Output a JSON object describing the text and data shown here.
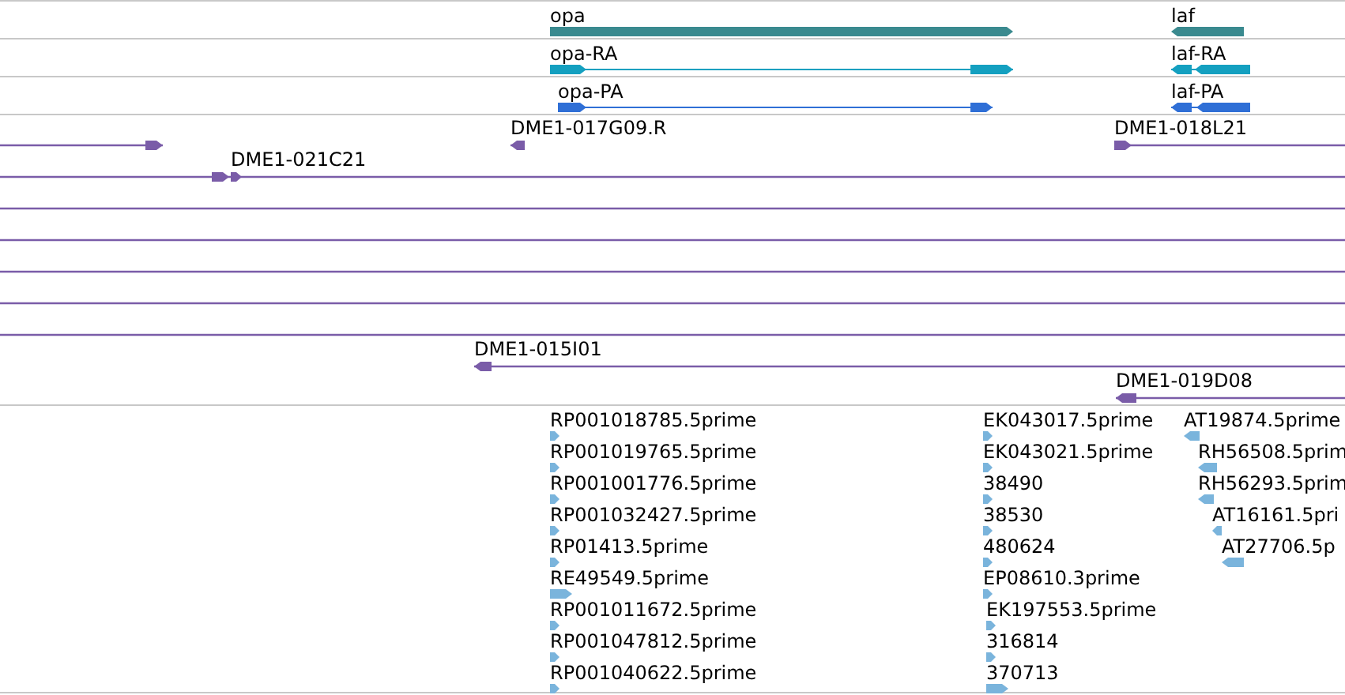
{
  "tracks": [
    {
      "kind": "gene",
      "lanes": [
        {
          "features": [
            {
              "label": "opa",
              "reverse": false
            },
            {
              "label": "laf",
              "reverse": true
            }
          ]
        },
        {
          "features": [
            {
              "label": "opa-RA",
              "reverse": false
            },
            {
              "label": "laf-RA",
              "reverse": true
            }
          ]
        },
        {
          "features": [
            {
              "label": "opa-PA",
              "reverse": false
            },
            {
              "label": "laf-PA",
              "reverse": true
            }
          ]
        }
      ]
    },
    {
      "kind": "clone",
      "lanes": [
        {
          "features": [
            {
              "reverse": false
            },
            {
              "label": "DME1-017G09.R",
              "reverse": true
            },
            {
              "label": "DME1-018L21",
              "reverse": false
            }
          ]
        },
        {
          "features": [
            {
              "label": "DME1-021C21",
              "reverse": false
            }
          ]
        },
        {
          "features": [
            {
              "kind": "continuation"
            }
          ]
        },
        {
          "features": [
            {
              "kind": "continuation"
            }
          ]
        },
        {
          "features": [
            {
              "kind": "continuation"
            }
          ]
        },
        {
          "features": [
            {
              "kind": "continuation"
            }
          ]
        },
        {
          "features": [
            {
              "kind": "continuation"
            }
          ]
        },
        {
          "features": [
            {
              "label": "DME1-015I01",
              "reverse": true
            }
          ]
        },
        {
          "features": [
            {
              "label": "DME1-019D08",
              "reverse": true
            }
          ]
        }
      ]
    },
    {
      "kind": "est",
      "stacks": [
        {
          "features": [
            {
              "label": "RP001018785.5prime",
              "reverse": false
            },
            {
              "label": "RP001019765.5prime",
              "reverse": false
            },
            {
              "label": "RP001001776.5prime",
              "reverse": false
            },
            {
              "label": "RP001032427.5prime",
              "reverse": false
            },
            {
              "label": "RP01413.5prime",
              "reverse": false
            },
            {
              "label": "RE49549.5prime",
              "reverse": false
            },
            {
              "label": "RP001011672.5prime",
              "reverse": false
            },
            {
              "label": "RP001047812.5prime",
              "reverse": false
            },
            {
              "label": "RP001040622.5prime",
              "reverse": false
            }
          ]
        },
        {
          "features": [
            {
              "label": "EK043017.5prime",
              "reverse": false
            },
            {
              "label": "EK043021.5prime",
              "reverse": false
            },
            {
              "label": "38490",
              "reverse": false
            },
            {
              "label": "38530",
              "reverse": false
            },
            {
              "label": "480624",
              "reverse": false
            },
            {
              "label": "EP08610.3prime",
              "reverse": false
            },
            {
              "label": "EK197553.5prime",
              "reverse": false
            },
            {
              "label": "316814",
              "reverse": false
            },
            {
              "label": "370713",
              "reverse": false
            }
          ]
        },
        {
          "features": [
            {
              "label": "AT19874.5prime",
              "reverse": true
            },
            {
              "label": "RH56508.5prim",
              "reverse": true
            },
            {
              "label": "RH56293.5prim",
              "reverse": true
            },
            {
              "label": "AT16161.5pri",
              "reverse": true
            },
            {
              "label": "AT27706.5p",
              "reverse": true
            }
          ]
        }
      ]
    }
  ]
}
